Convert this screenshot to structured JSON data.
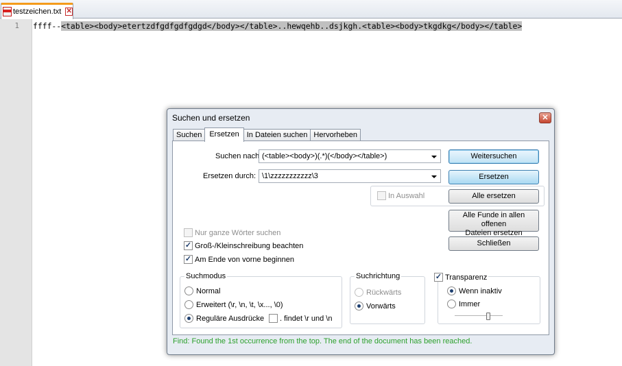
{
  "editor": {
    "tab": {
      "title": "testzeichen.txt",
      "close_glyph": "✕"
    },
    "line_number": "1",
    "line": {
      "prefix": "ffff--",
      "selected": "<table><body>etertzdfgdfgdfgdgd</body></table>..hewqehb..dsjkgh.<table><body>tkgdkg</body></table>"
    }
  },
  "dialog": {
    "title": "Suchen und ersetzen",
    "close_glyph": "✕",
    "tabs": [
      {
        "label": "Suchen",
        "active": false
      },
      {
        "label": "Ersetzen",
        "active": true
      },
      {
        "label": "In Dateien suchen",
        "active": false
      },
      {
        "label": "Hervorheben",
        "active": false
      }
    ],
    "find": {
      "label": "Suchen nach:",
      "value": "(<table><body>)(.*)(</body></table>)"
    },
    "replace": {
      "label": "Ersetzen durch:",
      "value": "\\1\\zzzzzzzzzzz\\3"
    },
    "in_selection": {
      "label": "In Auswahl",
      "checked": false,
      "enabled": false
    },
    "buttons": {
      "find_next": "Weitersuchen",
      "replace": "Ersetzen",
      "replace_all": "Alle ersetzen",
      "replace_all_open_line1": "Alle Funde in allen offenen",
      "replace_all_open_line2": "Dateien ersetzen",
      "close": "Schließen"
    },
    "options": {
      "whole_word": {
        "label": "Nur ganze Wörter suchen",
        "checked": false,
        "enabled": false
      },
      "match_case": {
        "label": "Groß-/Kleinschreibung beachten",
        "checked": true
      },
      "wrap_around": {
        "label": "Am Ende von vorne beginnen",
        "checked": true
      }
    },
    "search_mode": {
      "title": "Suchmodus",
      "normal": "Normal",
      "extended": "Erweitert (\\r, \\n, \\t, \\x..., \\0)",
      "regex": "Reguläre Ausdrücke",
      "dot_newline": ". findet \\r und \\n",
      "selected": "regex"
    },
    "direction": {
      "title": "Suchrichtung",
      "up": "Rückwärts",
      "down": "Vorwärts",
      "selected": "down"
    },
    "transparency": {
      "label": "Transparenz",
      "checked": true,
      "on_lose_focus": "Wenn inaktiv",
      "always": "Immer",
      "selected": "on_lose_focus",
      "level": 0.7
    },
    "status": "Find: Found the 1st occurrence from the top. The end of the document has been reached.",
    "check_glyph": "✓"
  }
}
